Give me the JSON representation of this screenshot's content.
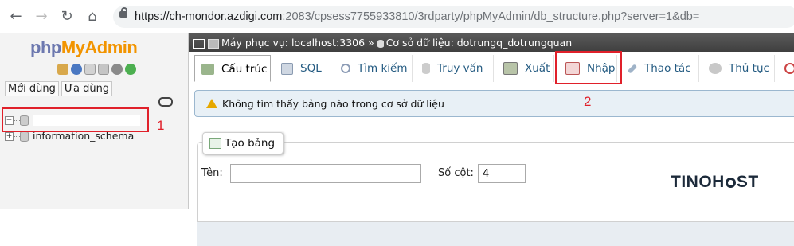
{
  "browser": {
    "url_domain": "https://ch-mondor.azdigi.com",
    "url_path": ":2083/cpsess7755933810/3rdparty/phpMyAdmin/db_structure.php?server=1&db="
  },
  "sidebar": {
    "logo_php": "php",
    "logo_myadmin": "MyAdmin",
    "tab_recent": "Mới dùng",
    "tab_favorites": "Ưa dùng",
    "tree": [
      {
        "label": "",
        "annotation": "1"
      },
      {
        "label": "information_schema"
      }
    ]
  },
  "breadcrumb": {
    "server_label": "Máy phục vụ: localhost:3306",
    "separator": "»",
    "database_label": "Cơ sở dữ liệu: dotrungq_dotrungquan"
  },
  "tabs": [
    {
      "label": "Cấu trúc",
      "icon": "structure-icon",
      "active": true
    },
    {
      "label": "SQL",
      "icon": "sql-icon"
    },
    {
      "label": "Tìm kiếm",
      "icon": "search-icon"
    },
    {
      "label": "Truy vấn",
      "icon": "query-icon"
    },
    {
      "label": "Xuất",
      "icon": "export-icon"
    },
    {
      "label": "Nhập",
      "icon": "import-icon",
      "annotation": "2"
    },
    {
      "label": "Thao tác",
      "icon": "wrench-icon"
    },
    {
      "label": "Thủ tục",
      "icon": "routines-icon"
    }
  ],
  "notice": {
    "text": "Không tìm thấy bảng nào trong cơ sở dữ liệu"
  },
  "create_table": {
    "legend": "Tạo bảng",
    "name_label": "Tên:",
    "name_value": "",
    "columns_label": "Số cột:",
    "columns_value": "4"
  },
  "annotations": {
    "num1": "1",
    "num2": "2"
  },
  "watermark": {
    "left": "TINOH",
    "right": "ST"
  },
  "colors": {
    "annotation_red": "#e0202a",
    "logo_blue": "#6c78af",
    "logo_orange": "#f29400",
    "link_blue": "#235a81"
  }
}
